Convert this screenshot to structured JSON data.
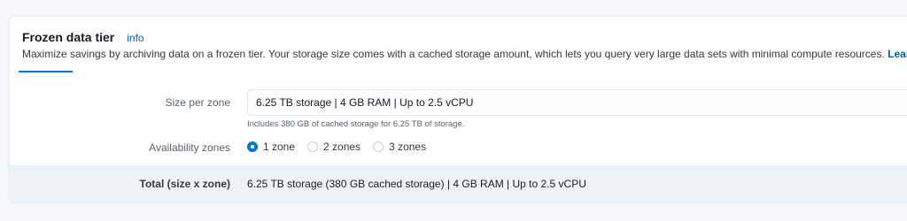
{
  "section": {
    "title": "Frozen data tier",
    "info_label": "info",
    "description": "Maximize savings by archiving data on a frozen tier. Your storage size comes with a cached storage amount, which lets you query very large data sets with minimal compute resources.",
    "learn_more_label": "Learn more",
    "external_link_icon": "external-link-icon"
  },
  "size_per_zone": {
    "label": "Size per zone",
    "selected_value": "6.25 TB storage | 4 GB RAM | Up to 2.5 vCPU",
    "help_text": "Includes 380 GB of cached storage for 6.25 TB of storage."
  },
  "availability_zones": {
    "label": "Availability zones",
    "options": [
      {
        "label": "1 zone",
        "checked": true
      },
      {
        "label": "2 zones",
        "checked": false
      },
      {
        "label": "3 zones",
        "checked": false
      }
    ]
  },
  "total": {
    "label": "Total (size x zone)",
    "value": "6.25 TB storage (380 GB cached storage)  |  4 GB RAM  |  Up to 2.5 vCPU"
  },
  "colors": {
    "accent": "#0077cc",
    "link": "#0061a6",
    "total_background": "#eef2f8"
  }
}
